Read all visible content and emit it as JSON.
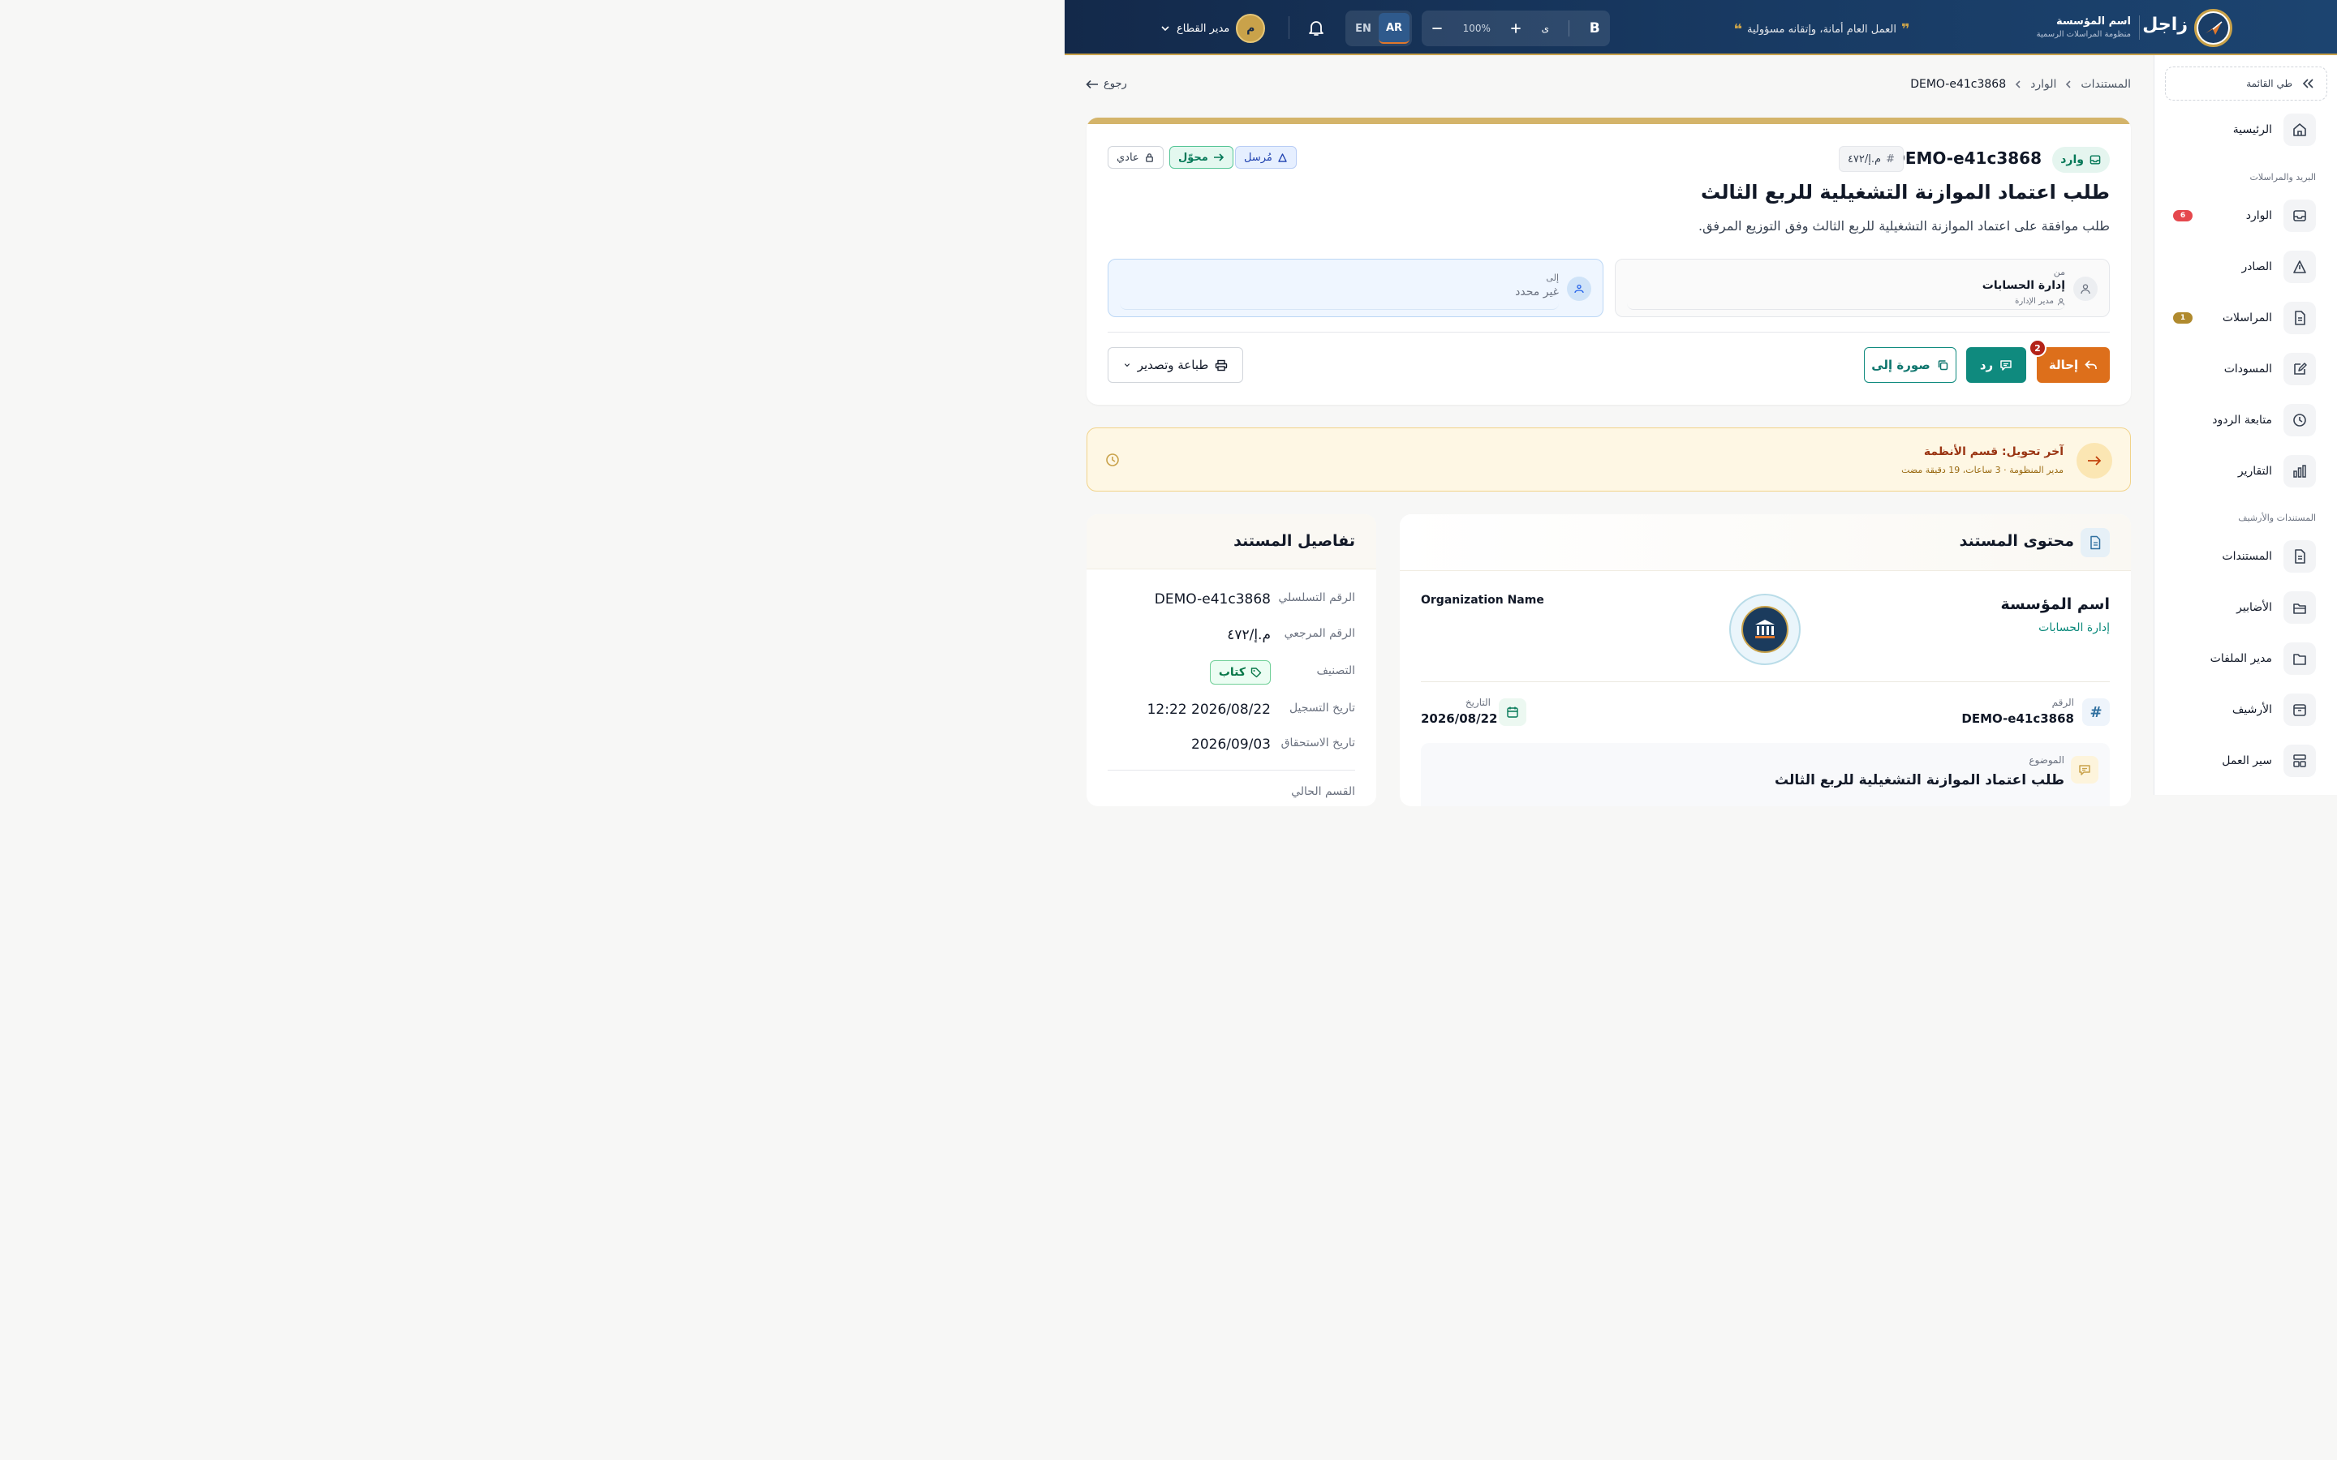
{
  "topbar": {
    "brand": "زاجل",
    "org_name": "اسم المؤسسة",
    "org_sub": "منظومة المراسلات الرسمية",
    "motto": "العمل العام أمانة، وإتقانه مسؤولية",
    "zoom": "100%",
    "font_a": "ى",
    "bold": "B",
    "lang_en": "EN",
    "lang_ar": "AR",
    "user_initial": "م",
    "user_name": "مدير القطاع"
  },
  "sidebar": {
    "collapse": "طي القائمة",
    "home": "الرئيسية",
    "section_mail": "البريد والمراسلات",
    "inbox": "الوارد",
    "inbox_badge": "6",
    "outbox": "الصادر",
    "correspondence": "المراسلات",
    "correspondence_badge": "1",
    "drafts": "المسودات",
    "followup": "متابعة الردود",
    "reports": "التقارير",
    "section_docs": "المستندات والأرشيف",
    "documents": "المستندات",
    "folders": "الأضابير",
    "file_manager": "مدير الملفات",
    "archive": "الأرشيف",
    "workflow": "سير العمل"
  },
  "breadcrumb": {
    "root": "المستندات",
    "mid": "الوارد",
    "current": "DEMO-e41c3868"
  },
  "back": "رجوع",
  "doc": {
    "type": "وارد",
    "id": "DEMO-e41c3868",
    "ref_chip": "م.إ/٤٧٢",
    "status_sent": "مُرسل",
    "status_forwarded": "محوّل",
    "status_normal": "عادي",
    "title": "طلب اعتماد الموازنة التشغيلية للربع الثالث",
    "description": "طلب موافقة على اعتماد الموازنة التشغيلية للربع الثالث وفق التوزيع المرفق.",
    "from_label": "من",
    "from_value": "إدارة الحسابات",
    "from_sub": "مدير الإدارة",
    "to_label": "إلى",
    "to_value": "غير محدد",
    "btn_forward": "إحالة",
    "btn_forward_badge": "2",
    "btn_reply": "رد",
    "btn_copy": "صورة إلى",
    "btn_print": "طباعة وتصدير"
  },
  "alert": {
    "title": "آخر تحويل: قسم الأنظمة",
    "sub": "مدير المنظومة · 3 ساعات، 19 دقيقة مضت"
  },
  "details": {
    "title": "تفاصيل المستند",
    "serial_label": "الرقم التسلسلي",
    "serial_value": "DEMO-e41c3868",
    "ref_label": "الرقم المرجعي",
    "ref_value": "م.إ/٤٧٢",
    "class_label": "التصنيف",
    "class_value": "كتاب",
    "reg_label": "تاريخ التسجيل",
    "reg_value": "2026/08/22 12:22",
    "due_label": "تاريخ الاستحقاق",
    "due_value": "2026/09/03",
    "current_dept_label": "القسم الحالي"
  },
  "content": {
    "title": "محتوى المستند",
    "org_ar": "اسم المؤسسة",
    "dept": "إدارة الحسابات",
    "org_en": "Organization Name",
    "number_label": "الرقم",
    "number_value": "DEMO-e41c3868",
    "date_label": "التاريخ",
    "date_value": "2026/08/22",
    "subject_label": "الموضوع",
    "subject_value": "طلب اعتماد الموازنة التشغيلية للربع الثالث"
  },
  "colors": {
    "navy": "#13294a",
    "gold": "#c9a24a",
    "teal": "#0f8a7e",
    "orange": "#dd6f1b",
    "badge_red": "#e5484d",
    "badge_gold": "#b08a2e"
  }
}
